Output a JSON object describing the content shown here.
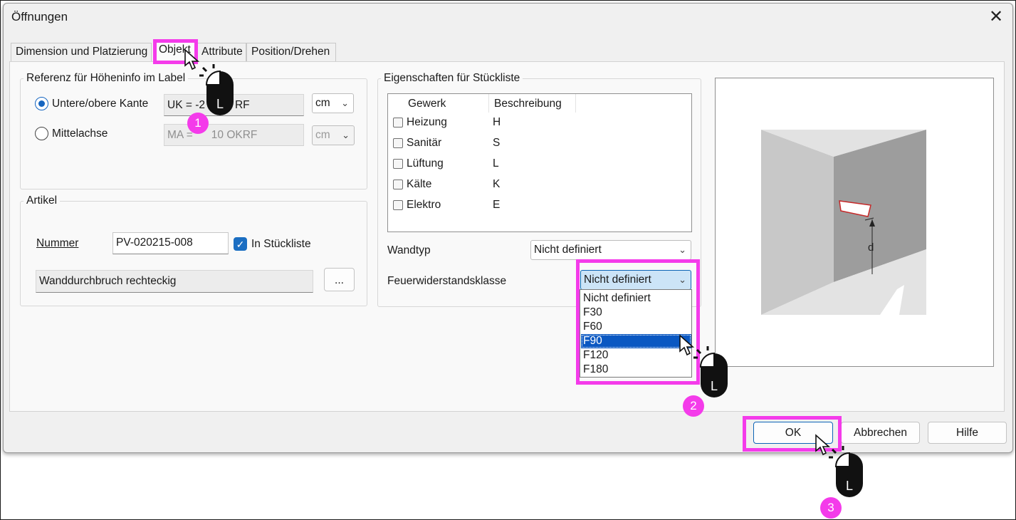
{
  "dialog": {
    "title": "Öffnungen",
    "close_glyph": "✕"
  },
  "tabs": [
    {
      "label": "Dimension und Platzierung"
    },
    {
      "label": "Objekt"
    },
    {
      "label": "Attribute"
    },
    {
      "label": "Position/Drehen"
    }
  ],
  "referenz": {
    "legend": "Referenz für Höheninfo im Label",
    "option1": {
      "label": "Untere/obere Kante",
      "selected": true,
      "value": "UK = -20 OKRF",
      "visible_value": "UK = -2",
      "visible_suffix": "RF",
      "unit": "cm"
    },
    "option2": {
      "label": "Mittelachse",
      "selected": false,
      "value": "MA = 110 OKRF",
      "visible_value": "MA =",
      "visible_suffix": "10 OKRF",
      "unit": "cm"
    }
  },
  "artikel": {
    "legend": "Artikel",
    "nummer_label": "Nummer",
    "nummer_value": "PV-020215-008",
    "in_stueckliste_label": "In Stückliste",
    "in_stueckliste_checked": true,
    "beschreibung_value": "Wanddurchbruch rechteckig",
    "browse_label": "..."
  },
  "eigenschaften": {
    "legend": "Eigenschaften für Stückliste",
    "columns": [
      "Gewerk",
      "Beschreibung"
    ],
    "rows": [
      {
        "gewerk": "Heizung",
        "beschreibung": "H",
        "checked": false
      },
      {
        "gewerk": "Sanitär",
        "beschreibung": "S",
        "checked": false
      },
      {
        "gewerk": "Lüftung",
        "beschreibung": "L",
        "checked": false
      },
      {
        "gewerk": "Kälte",
        "beschreibung": "K",
        "checked": false
      },
      {
        "gewerk": "Elektro",
        "beschreibung": "E",
        "checked": false
      }
    ],
    "wandtyp_label": "Wandtyp",
    "wandtyp_value": "Nicht definiert",
    "feuer_label": "Feuerwiderstandsklasse",
    "feuer_value": "Nicht definiert",
    "feuer_options": [
      "Nicht definiert",
      "F30",
      "F60",
      "F90",
      "F120",
      "F180"
    ],
    "feuer_highlighted": "F90"
  },
  "preview": {
    "dimension_label": "d"
  },
  "buttons": {
    "ok": "OK",
    "cancel": "Abbrechen",
    "help": "Hilfe"
  },
  "annotations": {
    "steps": [
      "1",
      "2",
      "3"
    ],
    "mouse_button_letter": "L",
    "highlight_color": "#f43bea"
  },
  "colors": {
    "accent": "#1565c0",
    "selection": "#0a58c2",
    "highlight": "#f43bea"
  }
}
